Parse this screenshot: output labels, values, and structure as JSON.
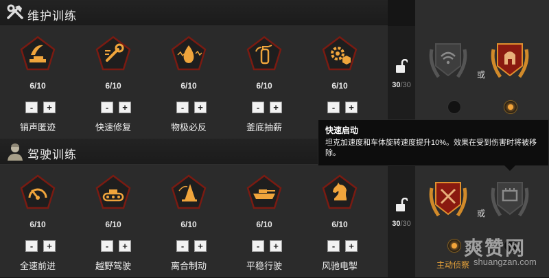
{
  "sections": {
    "maintenance": {
      "title": "维护训练",
      "icon": "wrench-hammer-icon",
      "skills": [
        {
          "name": "销声匿迹",
          "count": "6/10",
          "icon": "camo-tank-icon"
        },
        {
          "name": "快速修复",
          "count": "6/10",
          "icon": "wrench-icon"
        },
        {
          "name": "物极必反",
          "count": "6/10",
          "icon": "flame-drop-icon"
        },
        {
          "name": "釜底抽薪",
          "count": "6/10",
          "icon": "extinguisher-icon"
        },
        {
          "name": "",
          "count": "6/10",
          "icon": "gear-box-icon"
        }
      ],
      "points_done": "30",
      "points_total": "/30",
      "choice": {
        "left_icon": "wifi-emblem-icon",
        "right_icon": "helmet-emblem-icon",
        "or_label": "或",
        "selected": "right"
      }
    },
    "driving": {
      "title": "驾驶训练",
      "icon": "driver-portrait-icon",
      "skills": [
        {
          "name": "全速前进",
          "count": "6/10",
          "icon": "gauge-icon"
        },
        {
          "name": "越野驾驶",
          "count": "6/10",
          "icon": "tank-tread-icon"
        },
        {
          "name": "离合制动",
          "count": "6/10",
          "icon": "cone-icon"
        },
        {
          "name": "平稳行驶",
          "count": "6/10",
          "icon": "tank-side-icon"
        },
        {
          "name": "风驰电掣",
          "count": "6/10",
          "icon": "knight-icon"
        }
      ],
      "points_done": "30",
      "points_total": "/30",
      "choice": {
        "left_icon": "crossed-swords-emblem-icon",
        "right_icon": "engine-emblem-icon",
        "or_label": "或",
        "selected": "left",
        "label": "主动侦察"
      }
    }
  },
  "buttons": {
    "minus": "-",
    "plus": "+"
  },
  "tooltip": {
    "title": "快速启动",
    "description": "坦克加速度和车体旋转速度提升10%。效果在受到伤害时将被移除。"
  },
  "watermark": {
    "main": "爽赞网",
    "sub": "shuangzan.com"
  },
  "colors": {
    "accent": "#f3a43a",
    "badge_red": "#7a1b12",
    "badge_dark": "#3a3a3a"
  }
}
